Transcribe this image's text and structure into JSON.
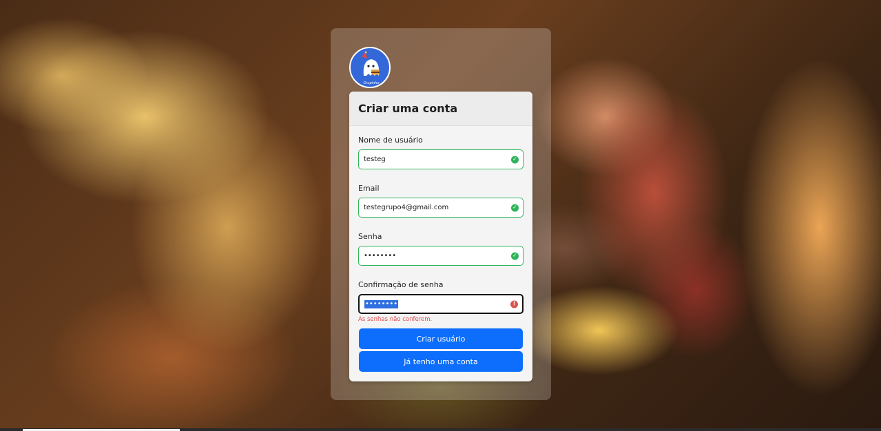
{
  "logo": {
    "name": "Grupo4 ghost burger logo",
    "caption": "Grupinho"
  },
  "form": {
    "title": "Criar uma conta",
    "fields": [
      {
        "label": "Nome de usuário",
        "value": "testeg",
        "status": "valid"
      },
      {
        "label": "Email",
        "value": "testegrupo4@gmail.com",
        "status": "valid"
      },
      {
        "label": "Senha",
        "value": "••••••••",
        "status": "valid"
      },
      {
        "label": "Confirmação de senha",
        "value": "••••••••",
        "status": "invalid",
        "error": "As senhas não conferem."
      }
    ],
    "submit_label": "Criar usuário",
    "login_label": "Já tenho uma conta"
  },
  "colors": {
    "valid": "#2fb35a",
    "invalid": "#d9534f",
    "primary": "#0d6efd",
    "error_text": "#e0484c"
  },
  "icons": {
    "valid": "check-circle-icon",
    "invalid": "exclamation-circle-icon"
  }
}
